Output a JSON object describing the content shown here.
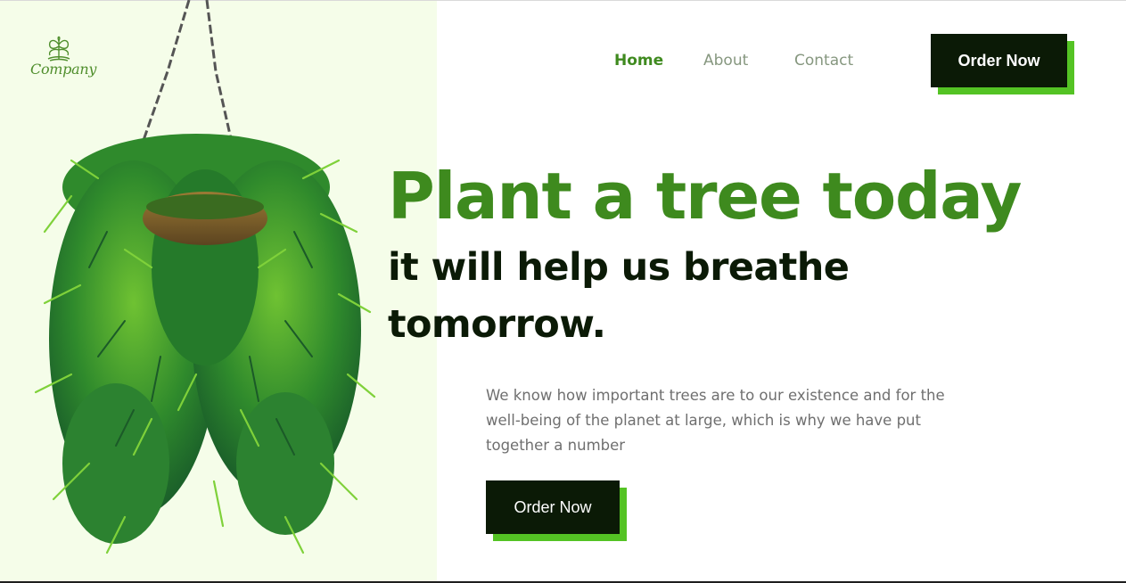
{
  "header": {
    "logo": {
      "text": "Company",
      "icon": "tree-icon"
    },
    "nav": [
      {
        "label": "Home",
        "active": true
      },
      {
        "label": "About",
        "active": false
      },
      {
        "label": "Contact",
        "active": false
      }
    ],
    "order_button_label": "Order Now"
  },
  "hero": {
    "title": "Plant a tree today",
    "subtitle_line1": "it will help us breathe",
    "subtitle_line2": "tomorrow.",
    "description": "We know how important trees are to our existence and for the well-being of the planet at large, which is why we have put together a number",
    "cta_label": "Order Now",
    "image": "hanging-plant-illustration"
  },
  "colors": {
    "accent_green": "#3e8a1e",
    "button_shadow_green": "#54c324",
    "dark_button": "#0b1a06",
    "left_panel_bg": "#f5fde9",
    "nav_inactive": "#86977f",
    "body_text": "#6f6f6f"
  }
}
